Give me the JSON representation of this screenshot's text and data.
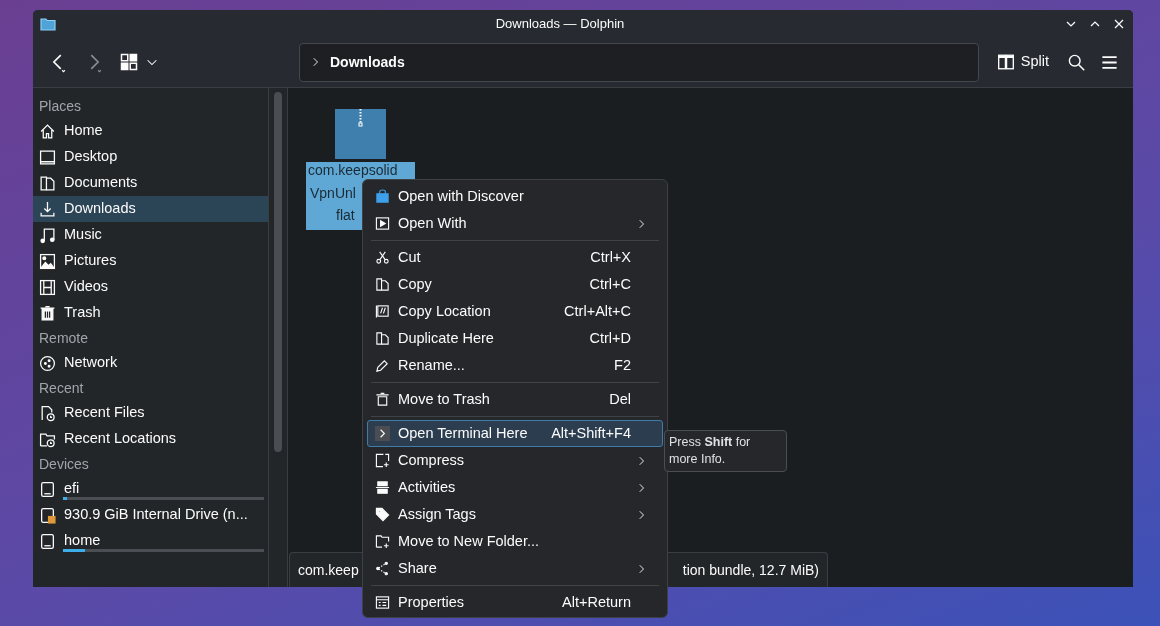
{
  "window": {
    "title": "Downloads — Dolphin"
  },
  "toolbar": {
    "breadcrumb": "Downloads",
    "split_label": "Split"
  },
  "sidebar": [
    {
      "heading": "Places",
      "items": [
        {
          "label": "Home",
          "selected": false
        },
        {
          "label": "Desktop",
          "selected": false
        },
        {
          "label": "Documents",
          "selected": false
        },
        {
          "label": "Downloads",
          "selected": true
        },
        {
          "label": "Music",
          "selected": false
        },
        {
          "label": "Pictures",
          "selected": false
        },
        {
          "label": "Videos",
          "selected": false
        },
        {
          "label": "Trash",
          "selected": false
        }
      ]
    },
    {
      "heading": "Remote",
      "items": [
        {
          "label": "Network",
          "selected": false
        }
      ]
    },
    {
      "heading": "Recent",
      "items": [
        {
          "label": "Recent Files",
          "selected": false
        },
        {
          "label": "Recent Locations",
          "selected": false
        }
      ]
    },
    {
      "heading": "Devices",
      "items": [
        {
          "label": "efi",
          "selected": false,
          "level": 0.02
        },
        {
          "label": "930.9 GiB Internal Drive (n...",
          "selected": false
        },
        {
          "label": "home",
          "selected": false,
          "level": 0.11
        }
      ]
    }
  ],
  "file": {
    "name_lines": [
      "com.keepsolid",
      "VpnUnl",
      "flat"
    ],
    "selected": true
  },
  "context_menu": [
    {
      "kind": "item",
      "label": "Open with Discover",
      "submenu": false,
      "selected": false
    },
    {
      "kind": "item",
      "label": "Open With",
      "submenu": true,
      "selected": false
    },
    {
      "kind": "separator"
    },
    {
      "kind": "item",
      "label": "Cut",
      "shortcut": "Ctrl+X",
      "submenu": false,
      "selected": false
    },
    {
      "kind": "item",
      "label": "Copy",
      "shortcut": "Ctrl+C",
      "submenu": false,
      "selected": false
    },
    {
      "kind": "item",
      "label": "Copy Location",
      "shortcut": "Ctrl+Alt+C",
      "submenu": false,
      "selected": false
    },
    {
      "kind": "item",
      "label": "Duplicate Here",
      "shortcut": "Ctrl+D",
      "submenu": false,
      "selected": false
    },
    {
      "kind": "item",
      "label": "Rename...",
      "shortcut": "F2",
      "submenu": false,
      "selected": false
    },
    {
      "kind": "separator"
    },
    {
      "kind": "item",
      "label": "Move to Trash",
      "shortcut": "Del",
      "submenu": false,
      "selected": false
    },
    {
      "kind": "separator"
    },
    {
      "kind": "item",
      "label": "Open Terminal Here",
      "shortcut": "Alt+Shift+F4",
      "submenu": false,
      "selected": true
    },
    {
      "kind": "item",
      "label": "Compress",
      "submenu": true,
      "selected": false
    },
    {
      "kind": "item",
      "label": "Activities",
      "submenu": true,
      "selected": false
    },
    {
      "kind": "item",
      "label": "Assign Tags",
      "submenu": true,
      "selected": false
    },
    {
      "kind": "item",
      "label": "Move to New Folder...",
      "submenu": false,
      "selected": false
    },
    {
      "kind": "item",
      "label": "Share",
      "submenu": true,
      "selected": false
    },
    {
      "kind": "separator"
    },
    {
      "kind": "item",
      "label": "Properties",
      "shortcut": "Alt+Return",
      "submenu": false,
      "selected": false
    }
  ],
  "tooltip": {
    "text": "Press **Shift** for more Info."
  },
  "status_bar": {
    "left": "com.keep",
    "right": "tion bundle, 12.7 MiB)"
  }
}
